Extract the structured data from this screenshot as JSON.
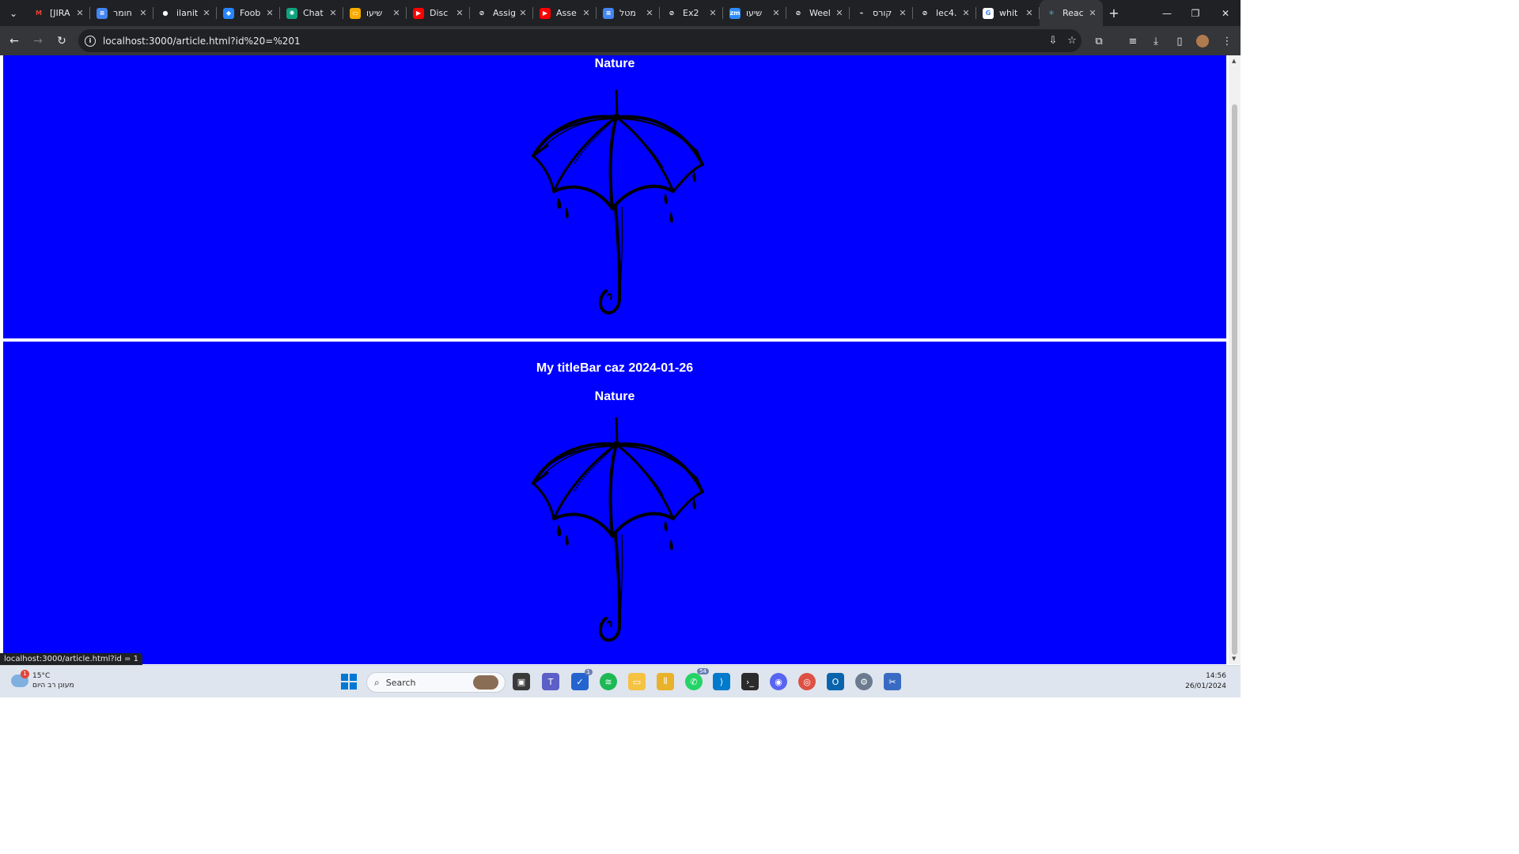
{
  "browser": {
    "tabs": [
      {
        "label": "[JIRA",
        "fav_color": "#ea4335",
        "fav_text": "M",
        "fav_text_color": "#ea4335",
        "fav_bg": "transparent"
      },
      {
        "label": "חומר",
        "fav_color": "#4285f4",
        "fav_text": "≡"
      },
      {
        "label": "ilanit",
        "fav_color": "#202124",
        "fav_text": "●"
      },
      {
        "label": "Foob",
        "fav_color": "#2684ff",
        "fav_text": "◆"
      },
      {
        "label": "Chat",
        "fav_color": "#10a37f",
        "fav_text": "✺"
      },
      {
        "label": "שיעו",
        "fav_color": "#f9ab00",
        "fav_text": "▭"
      },
      {
        "label": "Disc",
        "fav_color": "#ff0000",
        "fav_text": "▶"
      },
      {
        "label": "Assig",
        "fav_color": "#202124",
        "fav_text": "⊘"
      },
      {
        "label": "Asse",
        "fav_color": "#ff0000",
        "fav_text": "▶"
      },
      {
        "label": "מטל",
        "fav_color": "#4285f4",
        "fav_text": "≡"
      },
      {
        "label": "Ex2",
        "fav_color": "#202124",
        "fav_text": "⊘"
      },
      {
        "label": "שיעו",
        "fav_color": "#2d8cff",
        "fav_text": "zm"
      },
      {
        "label": "Weel",
        "fav_color": "#202124",
        "fav_text": "⊘"
      },
      {
        "label": "קורס",
        "fav_color": "#202124",
        "fav_text": "⌁"
      },
      {
        "label": "lec4.",
        "fav_color": "#202124",
        "fav_text": "⊘"
      },
      {
        "label": "whit",
        "fav_color": "#ffffff",
        "fav_text": "G",
        "fav_text_color": "#4285f4"
      },
      {
        "label": "Reac",
        "fav_color": "#35363a",
        "fav_text": "⚛",
        "fav_text_color": "#61dafb",
        "active": true
      }
    ],
    "url": "localhost:3000/article.html?id%20=%201",
    "status_url": "localhost:3000/article.html?id = 1"
  },
  "page": {
    "articles": [
      {
        "title": "",
        "subtitle": "Nature"
      },
      {
        "title": "My titleBar caz 2024-01-26",
        "subtitle": "Nature"
      }
    ]
  },
  "taskbar": {
    "weather_temp": "15°C",
    "weather_desc": "מעונן רב היום",
    "weather_badge": "1",
    "search_placeholder": "Search",
    "whatsapp_badge": "54",
    "todo_badge": "1",
    "time": "14:56",
    "date": "26/01/2024"
  }
}
